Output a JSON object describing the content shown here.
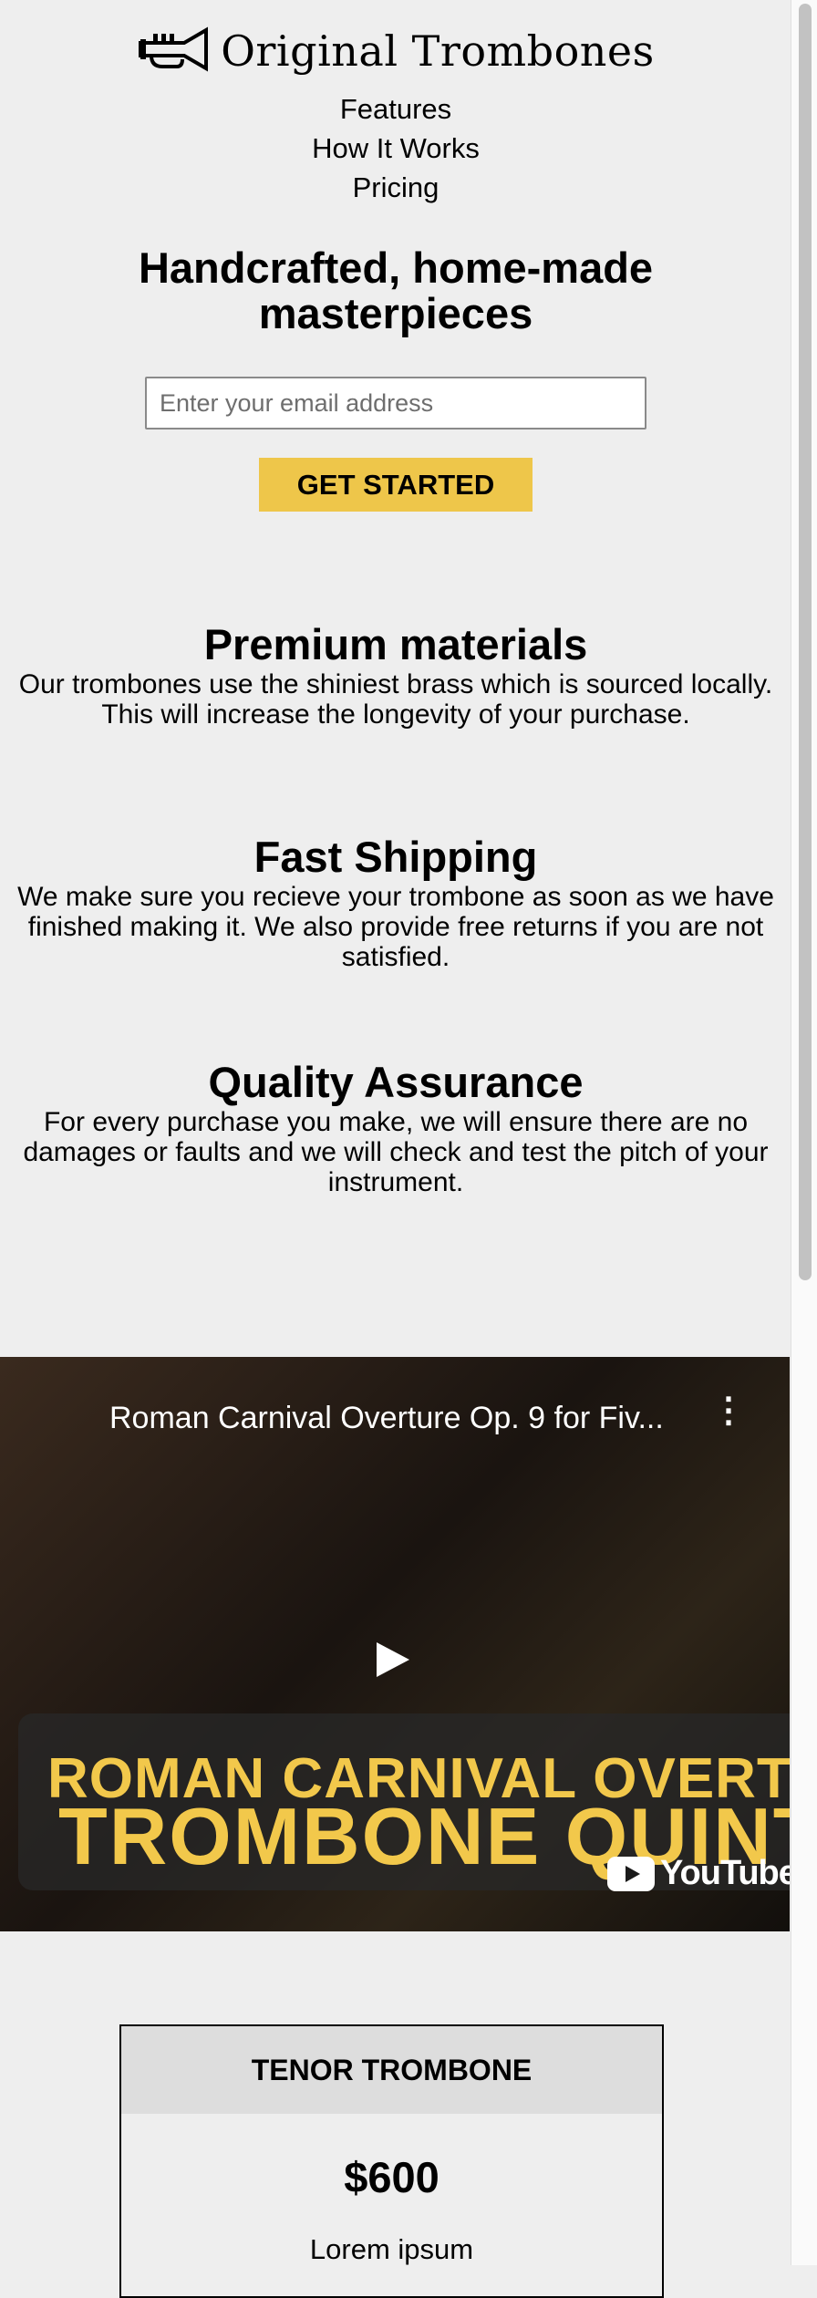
{
  "header": {
    "brand": "Original Trombones",
    "nav": [
      "Features",
      "How It Works",
      "Pricing"
    ]
  },
  "hero": {
    "title": "Handcrafted, home-made masterpieces",
    "email_placeholder": "Enter your email address",
    "cta": "GET STARTED"
  },
  "features": [
    {
      "title": "Premium materials",
      "text": "Our trombones use the shiniest brass which is sourced locally. This will increase the longevity of your purchase."
    },
    {
      "title": "Fast Shipping",
      "text": "We make sure you recieve your trombone as soon as we have finished making it. We also provide free returns if you are not satisfied."
    },
    {
      "title": "Quality Assurance",
      "text": "For every purchase you make, we will ensure there are no damages or faults and we will check and test the pitch of your instrument."
    }
  ],
  "video": {
    "title": "Roman Carnival Overture Op. 9 for Fiv...",
    "banner_line1": "ROMAN CARNIVAL OVERTU",
    "banner_line2": "TROMBONE QUINT",
    "platform": "YouTube"
  },
  "pricing": {
    "name": "TENOR TROMBONE",
    "price": "$600",
    "feature": "Lorem ipsum"
  },
  "colors": {
    "background": "#eeeeee",
    "accent": "#eec64a",
    "banner_text": "#f2c84b"
  },
  "icons": {
    "logo": "trumpet-icon",
    "video_menu": "more-vertical-icon",
    "play": "play-icon",
    "youtube": "youtube-logo-icon"
  }
}
